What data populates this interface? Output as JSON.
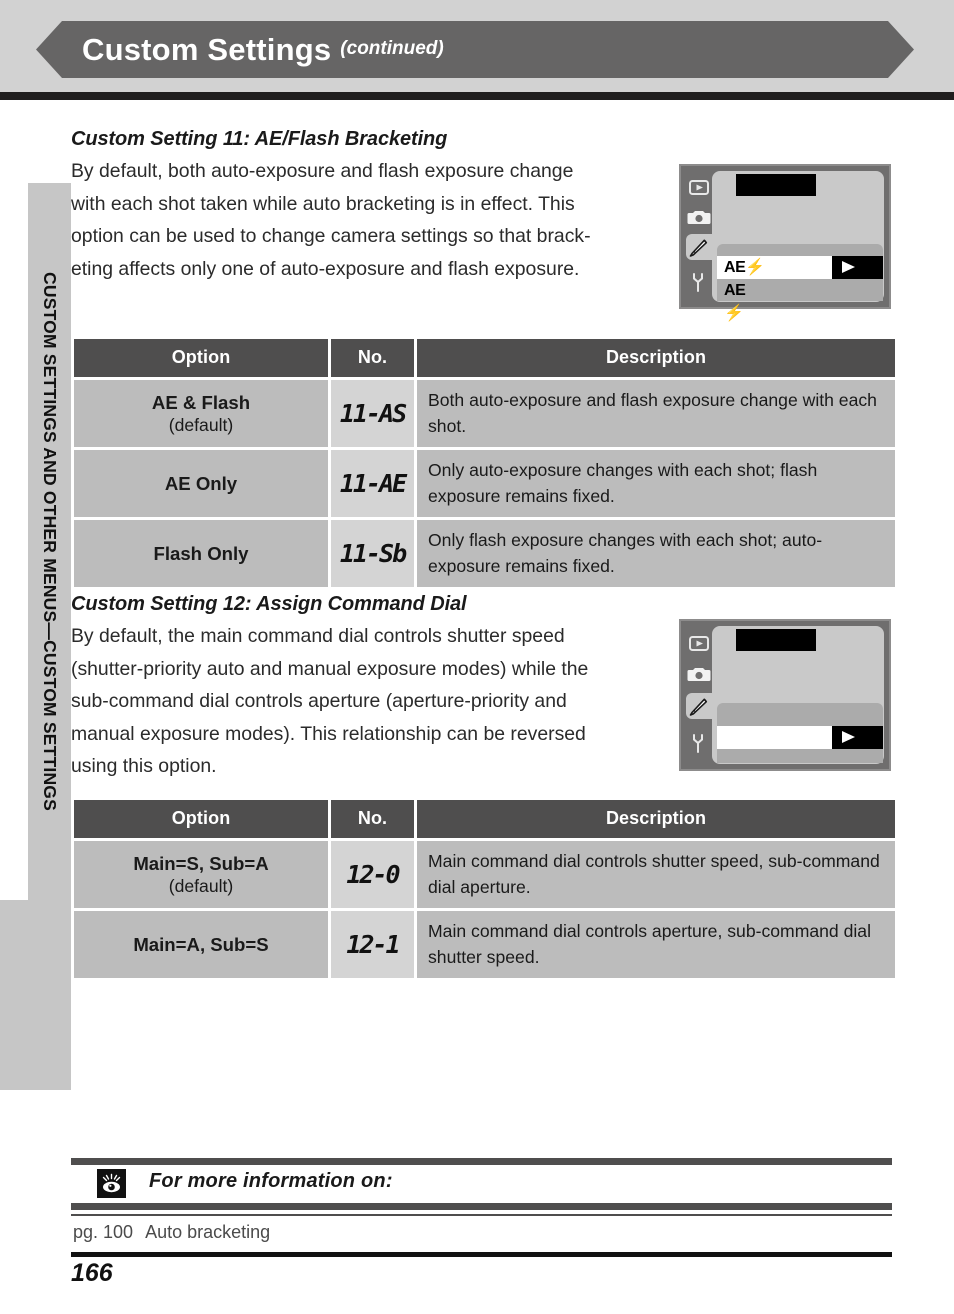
{
  "header": {
    "title": "Custom Settings",
    "continued": "(continued)"
  },
  "side_tab": {
    "label": "CUSTOM SETTINGS AND OTHER MENUS—CUSTOM SETTINGS"
  },
  "sections": [
    {
      "heading": "Custom Setting 11: AE/Flash Bracketing",
      "paragraph_lines": [
        "By default, both auto-exposure and flash exposure change",
        "with each shot taken while auto bracketing is in effect. This",
        "option can be used to change camera settings so that brack-",
        "eting affects only one of auto-exposure and flash exposure."
      ],
      "lcd": {
        "icons": [
          "playback-icon",
          "camera-icon",
          "pencil-icon",
          "wrench-icon"
        ],
        "selected_icon": "pencil-icon",
        "menu_rows": [
          {
            "label": "AE⚡",
            "highlighted": true
          },
          {
            "label": "AE",
            "highlighted": false
          },
          {
            "label": "⚡",
            "highlighted": false
          }
        ]
      },
      "table": {
        "columns": [
          "Option",
          "No.",
          "Description"
        ],
        "rows": [
          {
            "option": "AE & Flash",
            "option_note": "(default)",
            "no": "11-AS",
            "description": "Both auto-exposure and flash exposure change with each shot."
          },
          {
            "option": "AE Only",
            "option_note": "",
            "no": "11-AE",
            "description": "Only auto-exposure changes with each shot; flash exposure remains fixed."
          },
          {
            "option": "Flash Only",
            "option_note": "",
            "no": "11-Sb",
            "description": "Only flash exposure changes with each shot; auto-exposure remains fixed."
          }
        ]
      }
    },
    {
      "heading": "Custom Setting 12: Assign Command Dial",
      "paragraph_lines": [
        "By default, the main command dial controls shutter speed",
        "(shutter-priority auto and manual exposure modes) while the",
        "sub-command dial controls aperture (aperture-priority and",
        "manual exposure modes).  This relationship can be reversed",
        "using this option."
      ],
      "lcd": {
        "icons": [
          "playback-icon",
          "camera-icon",
          "pencil-icon",
          "wrench-icon"
        ],
        "selected_icon": "pencil-icon",
        "menu_rows": [
          {
            "label": "",
            "highlighted": false
          },
          {
            "label": "",
            "highlighted": true
          },
          {
            "label": "",
            "highlighted": false
          }
        ]
      },
      "table": {
        "columns": [
          "Option",
          "No.",
          "Description"
        ],
        "rows": [
          {
            "option": "Main=S, Sub=A",
            "option_note": "(default)",
            "no": "12-0",
            "description": "Main command dial controls shutter speed, sub-command dial aperture."
          },
          {
            "option": "Main=A, Sub=S",
            "option_note": "",
            "no": "12-1",
            "description": "Main command dial controls aperture, sub-command dial shutter speed."
          }
        ]
      }
    }
  ],
  "footer": {
    "icon": "eye-icon",
    "heading": "For more information on:",
    "reference_page": "pg. 100",
    "reference_topic": "Auto bracketing",
    "page_number": "166"
  },
  "colors": {
    "banner": "#666565",
    "band": "#d2d2d2",
    "table_header": "#4f4e4e",
    "table_cell": "#bcbcbc",
    "table_no_cell": "#d4d4d4",
    "lcd_frame": "#6f6e6e",
    "lcd_screen": "#c9c9c9"
  }
}
